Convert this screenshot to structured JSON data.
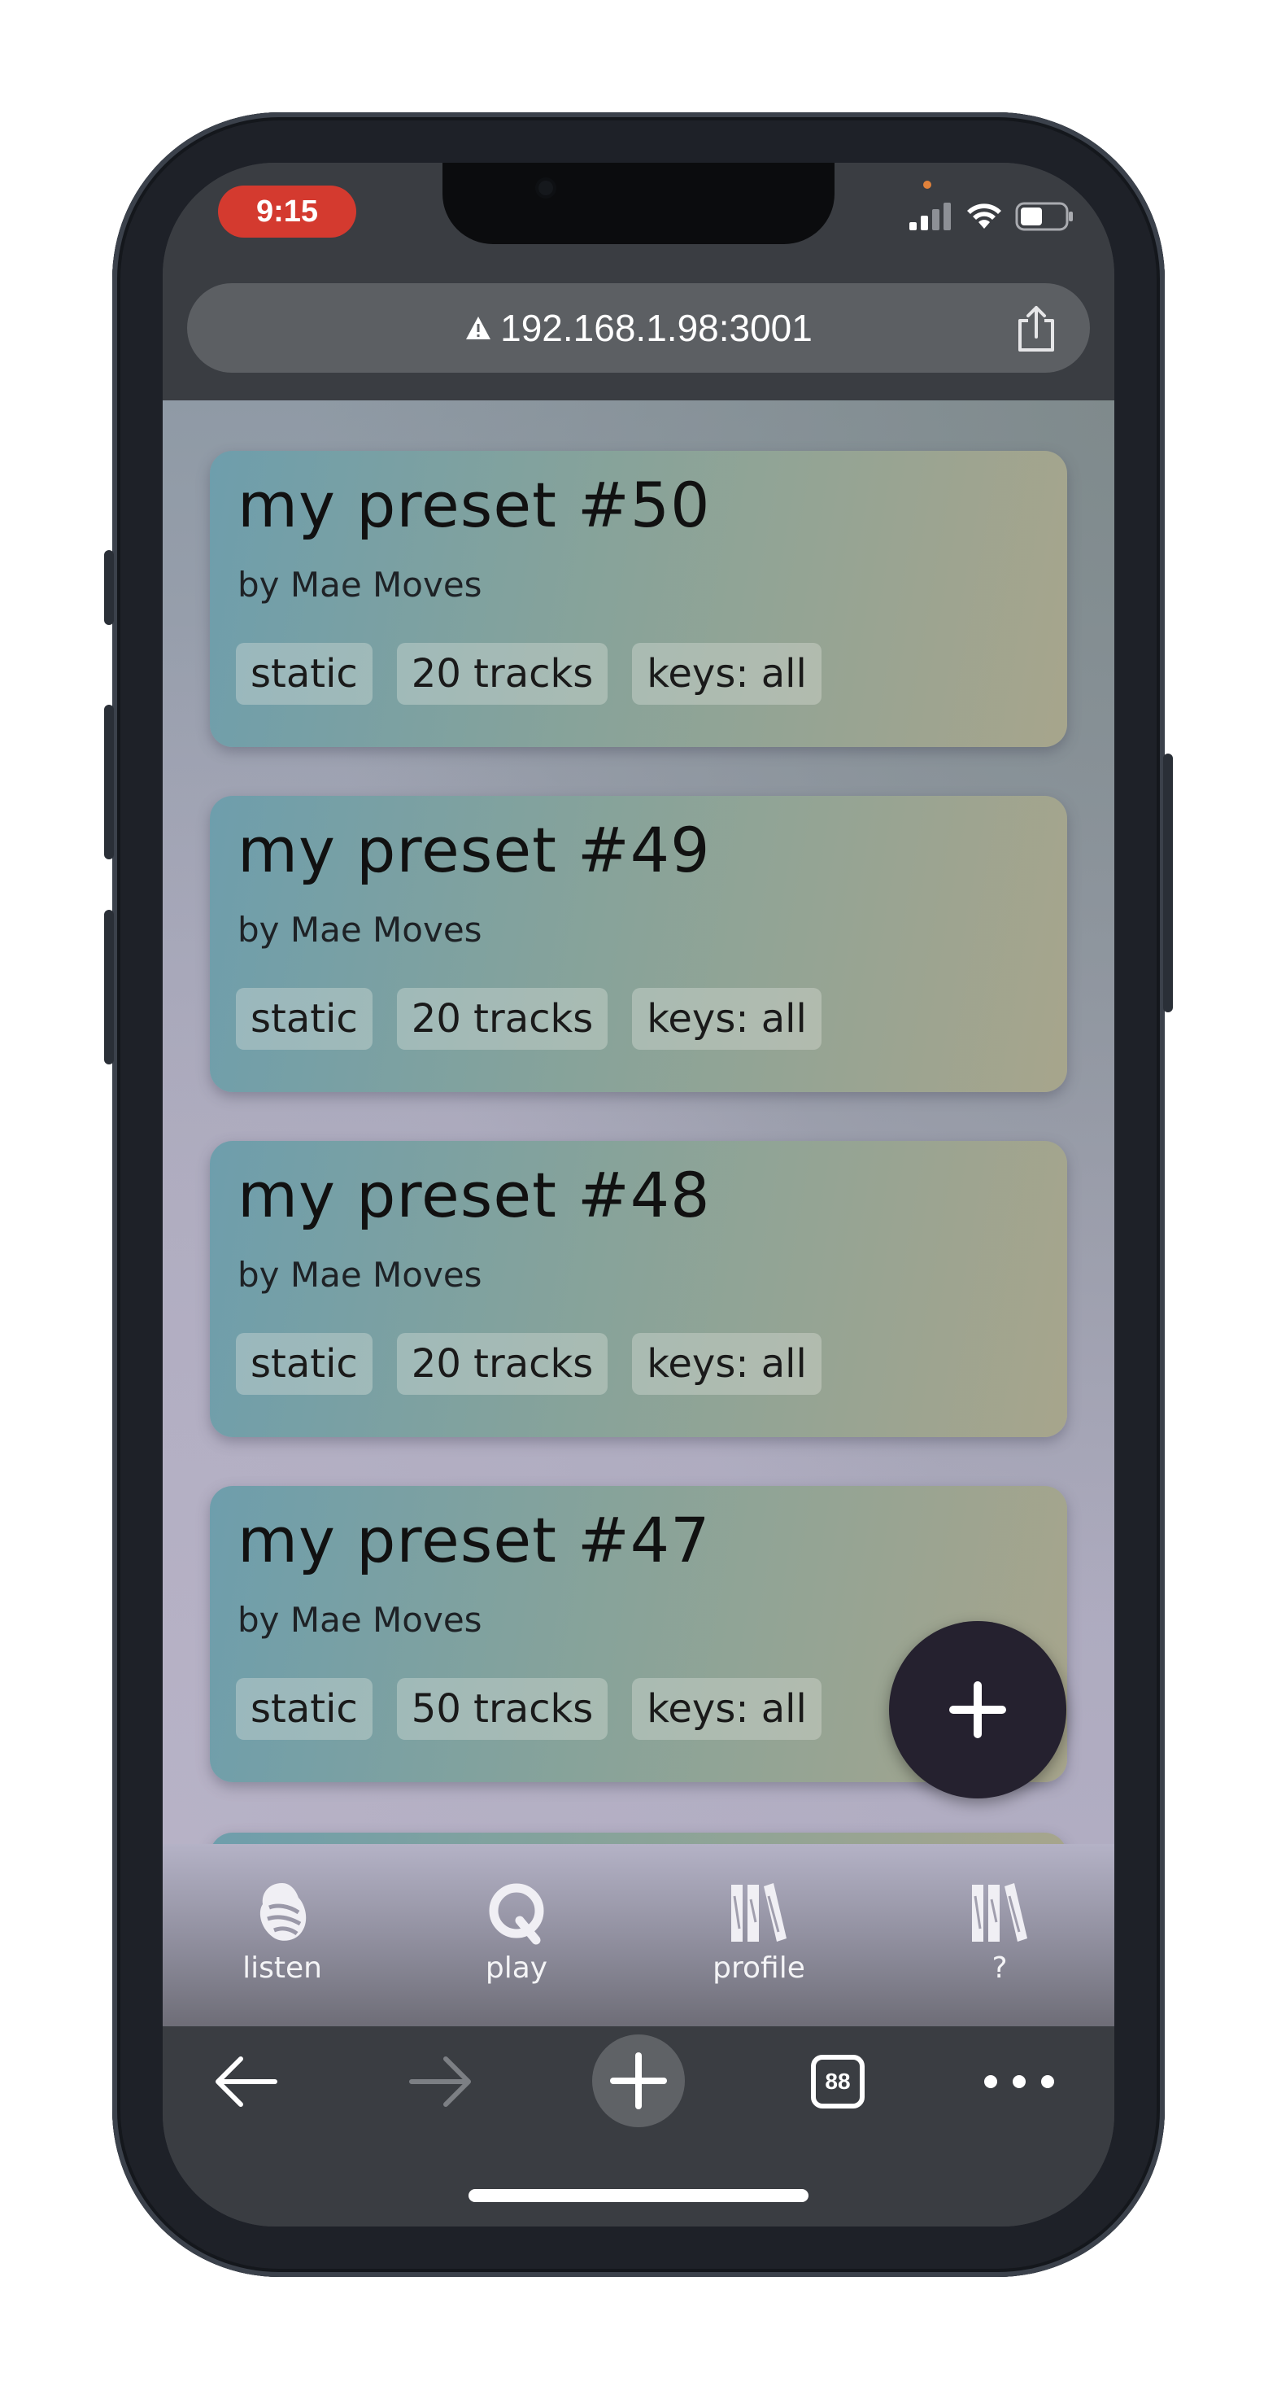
{
  "status": {
    "time": "9:15"
  },
  "url_bar": {
    "url": "192.168.1.98:3001",
    "share_icon": "share-icon",
    "warning_icon": "warning-triangle-icon"
  },
  "presets": [
    {
      "title": "my preset #50",
      "author": "by Mae Moves",
      "tags": [
        "static",
        "20 tracks",
        "keys: all"
      ]
    },
    {
      "title": "my preset #49",
      "author": "by Mae Moves",
      "tags": [
        "static",
        "20 tracks",
        "keys: all"
      ]
    },
    {
      "title": "my preset #48",
      "author": "by Mae Moves",
      "tags": [
        "static",
        "20 tracks",
        "keys: all"
      ]
    },
    {
      "title": "my preset #47",
      "author": "by Mae Moves",
      "tags": [
        "static",
        "50 tracks",
        "keys: all"
      ]
    }
  ],
  "fab": {
    "icon": "plus-icon"
  },
  "app_nav": [
    {
      "label": "listen",
      "icon": "listen-icon"
    },
    {
      "label": "play",
      "icon": "play-icon"
    },
    {
      "label": "profile",
      "icon": "profile-icon"
    },
    {
      "label": "?",
      "icon": "help-icon"
    }
  ],
  "browser_toolbar": {
    "tabs_count": "88"
  },
  "colors": {
    "fab": "#25212f",
    "time_pill": "#d43a2f",
    "url_bar": "#5c5f63"
  }
}
